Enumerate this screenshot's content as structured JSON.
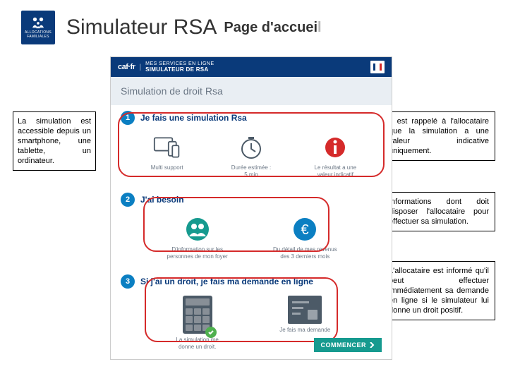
{
  "header": {
    "title": "Simulateur RSA",
    "subtitle_prefix": "Page d'accuei",
    "subtitle_accent": "l",
    "logo_small_line1": "ALLOCATIONS",
    "logo_small_line2": "FAMILIALES"
  },
  "left_note": "La simulation est accessible depuis un smartphone, une tablette, un ordinateur.",
  "callouts": {
    "c1": "Il est rappelé à l'allocataire que la simulation a une valeur indicative uniquement.",
    "c2": "Informations dont doit disposer l'allocataire pour effectuer sa simulation.",
    "c3": "L'allocataire est informé qu'il peut effectuer immédiatement sa demande en ligne si le simulateur lui donne un droit positif."
  },
  "screen": {
    "brand": "caf·fr",
    "topbar_line1": "MES SERVICES EN LIGNE",
    "topbar_line2": "SIMULATEUR DE RSA",
    "hero": "Simulation de droit Rsa",
    "step1": {
      "num": "1",
      "title": "Je fais une simulation Rsa",
      "cells": [
        {
          "label": "Multi support"
        },
        {
          "label": "Durée estimée :",
          "sub": "5 min"
        },
        {
          "label": "Le résultat a une",
          "sub": "valeur indicatif"
        }
      ]
    },
    "step2": {
      "num": "2",
      "title": "J'ai besoin",
      "cells": [
        {
          "label": "D'information sur les",
          "sub": "personnes de mon foyer"
        },
        {
          "label": "Du détail de mes revenus",
          "sub": "des 3 derniers mois"
        }
      ]
    },
    "step3": {
      "num": "3",
      "title": "Si j'ai un droit, je fais ma demande en ligne",
      "cells": [
        {
          "label": "La simulation me",
          "sub": "donne un droit."
        },
        {
          "label": "Je fais ma demande"
        }
      ]
    },
    "cta": "COMMENCER"
  }
}
